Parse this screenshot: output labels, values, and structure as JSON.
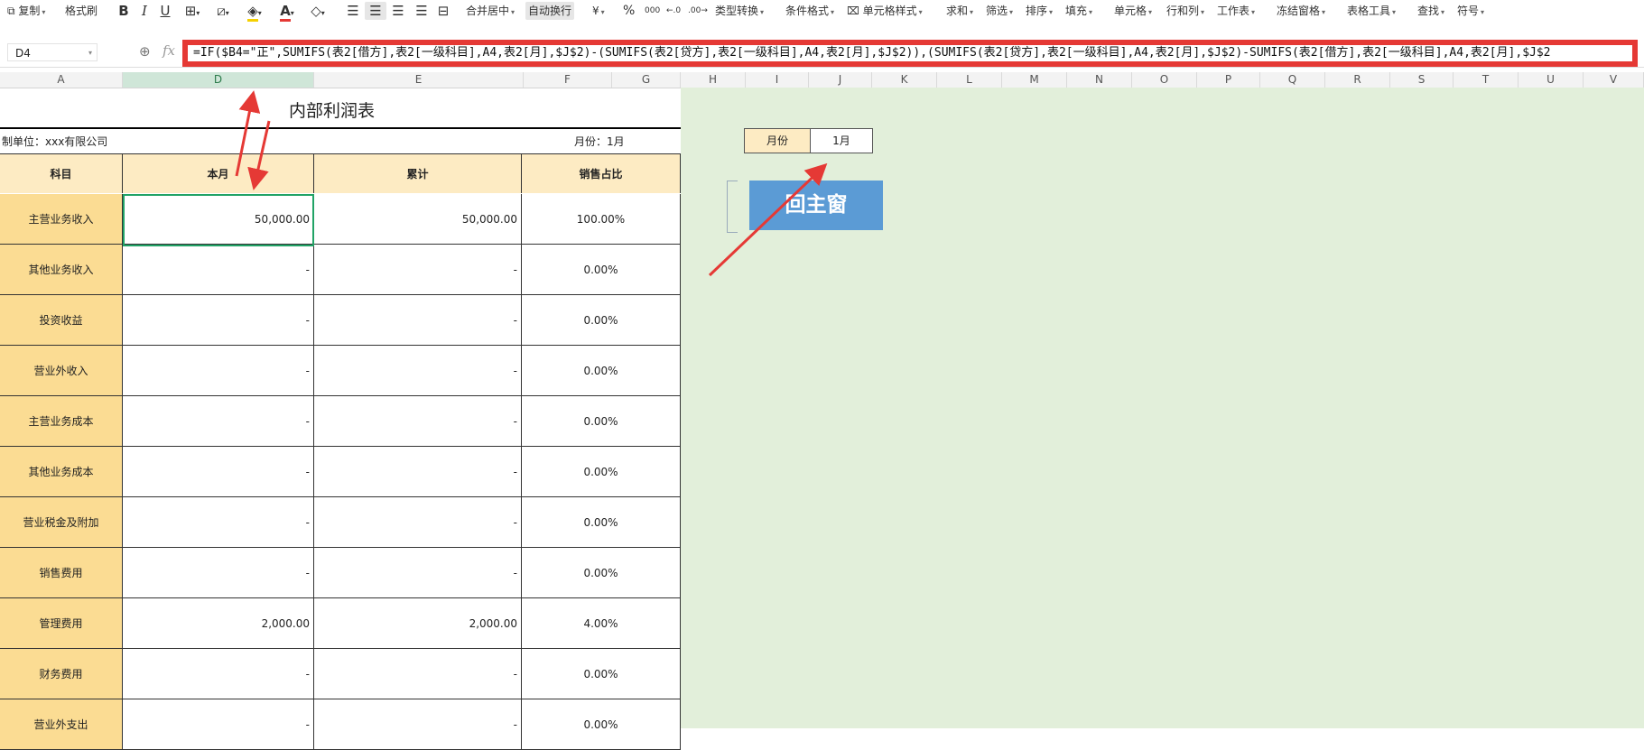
{
  "ribbon": {
    "copy": "复制",
    "format_painter": "格式刷",
    "bold": "B",
    "italic": "I",
    "underline": "U",
    "merge_center": "合并居中",
    "wrap_text": "自动换行",
    "currency": "¥",
    "percent": "%",
    "thousands": "000",
    "type_convert": "类型转换",
    "conditional_format": "条件格式",
    "cell_style": "单元格样式",
    "sum": "求和",
    "filter": "筛选",
    "sort": "排序",
    "fill": "填充",
    "cell": "单元格",
    "row_col": "行和列",
    "worksheet": "工作表",
    "freeze": "冻结窗格",
    "table_tools": "表格工具",
    "find": "查找",
    "symbol": "符号"
  },
  "formula_bar": {
    "name_box": "D4",
    "fx": "fx",
    "formula": "=IF($B4=\"正\",SUMIFS(表2[借方],表2[一级科目],A4,表2[月],$J$2)-(SUMIFS(表2[贷方],表2[一级科目],A4,表2[月],$J$2)),(SUMIFS(表2[贷方],表2[一级科目],A4,表2[月],$J$2)-SUMIFS(表2[借方],表2[一级科目],A4,表2[月],$J$2"
  },
  "columns": [
    "A",
    "D",
    "E",
    "F",
    "G",
    "H",
    "I",
    "J",
    "K",
    "L",
    "M",
    "N",
    "O",
    "P",
    "Q",
    "R",
    "S",
    "T",
    "U",
    "V"
  ],
  "sheet": {
    "title": "内部利润表",
    "company": "制单位：xxx有限公司",
    "month_label": "月份：1月",
    "headers": [
      "科目",
      "本月",
      "累计",
      "销售占比"
    ],
    "rows": [
      {
        "label": "主营业务收入",
        "month": "50,000.00",
        "total": "50,000.00",
        "ratio": "100.00%"
      },
      {
        "label": "其他业务收入",
        "month": "-",
        "total": "-",
        "ratio": "0.00%"
      },
      {
        "label": "投资收益",
        "month": "-",
        "total": "-",
        "ratio": "0.00%"
      },
      {
        "label": "营业外收入",
        "month": "-",
        "total": "-",
        "ratio": "0.00%"
      },
      {
        "label": "主营业务成本",
        "month": "-",
        "total": "-",
        "ratio": "0.00%"
      },
      {
        "label": "其他业务成本",
        "month": "-",
        "total": "-",
        "ratio": "0.00%"
      },
      {
        "label": "营业税金及附加",
        "month": "-",
        "total": "-",
        "ratio": "0.00%"
      },
      {
        "label": "销售费用",
        "month": "-",
        "total": "-",
        "ratio": "0.00%"
      },
      {
        "label": "管理费用",
        "month": "2,000.00",
        "total": "2,000.00",
        "ratio": "4.00%"
      },
      {
        "label": "财务费用",
        "month": "-",
        "total": "-",
        "ratio": "0.00%"
      },
      {
        "label": "营业外支出",
        "month": "-",
        "total": "-",
        "ratio": "0.00%"
      }
    ]
  },
  "panel": {
    "month_label": "月份",
    "month_value": "1月",
    "back_button": "回主窗"
  },
  "colors": {
    "annotation_red": "#e53935",
    "header_fill": "#fdebc3",
    "label_fill": "#fbdc93",
    "button_blue": "#5b9bd5",
    "side_green": "#e2efda"
  }
}
